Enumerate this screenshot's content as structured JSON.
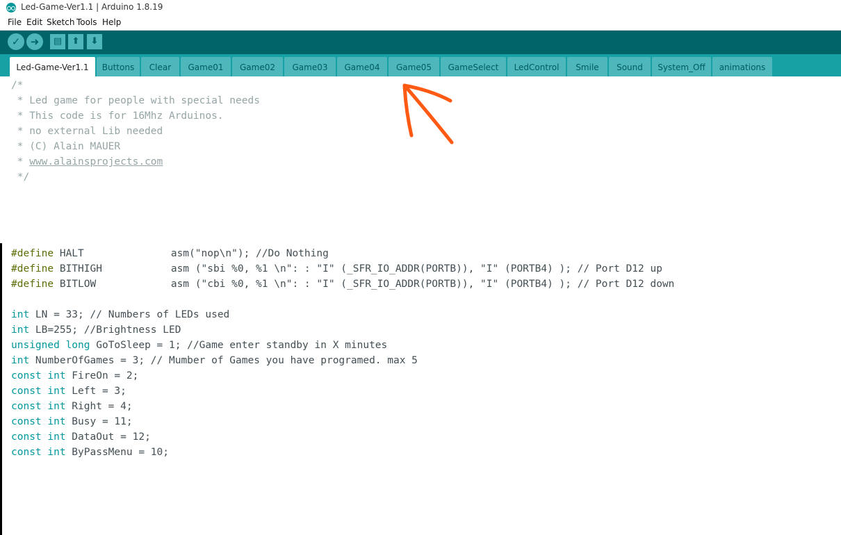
{
  "window": {
    "title": "Led-Game-Ver1.1 | Arduino 1.8.19"
  },
  "menu": [
    "File",
    "Edit",
    "Sketch",
    "Tools",
    "Help"
  ],
  "toolbar": {
    "verify_icon": "check-icon",
    "upload_icon": "arrow-right-icon",
    "new_icon": "new-document-icon",
    "open_icon": "arrow-up-icon",
    "save_icon": "arrow-down-icon"
  },
  "tabs": [
    "Led-Game-Ver1.1",
    "Buttons",
    "Clear",
    "Game01",
    "Game02",
    "Game03",
    "Game04",
    "Game05",
    "GameSelect",
    "LedControl",
    "Smile",
    "Sound",
    "System_Off",
    "animations"
  ],
  "active_tab": "Led-Game-Ver1.1",
  "colors": {
    "toolbar": "#006468",
    "tabstrip": "#17a1a5",
    "tab": "#4db7bb",
    "keyword": "#00979c",
    "comment": "#95a5a6",
    "annotation_arrow": "#ff5a14"
  },
  "code": {
    "comment_block": [
      "/*",
      " * Led game for people with special needs",
      " * This code is for 16Mhz Arduinos.",
      " * no external Lib needed",
      " * (C) Alain MAUER",
      " * ",
      " */"
    ],
    "comment_link": "www.alainsprojects.com",
    "defines": [
      {
        "name": "HALT",
        "body": "asm(\"nop\\n\"); //Do Nothing"
      },
      {
        "name": "BITHIGH",
        "body": "asm (\"sbi %0, %1 \\n\": : \"I\" (_SFR_IO_ADDR(PORTB)), \"I\" (PORTB4) ); // Port D12 up"
      },
      {
        "name": "BITLOW",
        "body": "asm (\"cbi %0, %1 \\n\": : \"I\" (_SFR_IO_ADDR(PORTB)), \"I\" (PORTB4) ); // Port D12 down"
      }
    ],
    "declarations": [
      {
        "type": "int",
        "rest": " LN = 33; // Numbers of LEDs used"
      },
      {
        "type": "int",
        "rest": " LB=255; //Brightness LED"
      },
      {
        "type": "unsigned long",
        "rest": " GoToSleep = 1; //Game enter standby in X minutes"
      },
      {
        "type": "int",
        "rest": " NumberOfGames = 3; // Mumber of Games you have programed. max 5"
      },
      {
        "type": "const int",
        "rest": " FireOn = 2;"
      },
      {
        "type": "const int",
        "rest": " Left = 3;"
      },
      {
        "type": "const int",
        "rest": " Right = 4;"
      },
      {
        "type": "const int",
        "rest": " Busy = 11;"
      },
      {
        "type": "const int",
        "rest": " DataOut = 12;"
      },
      {
        "type": "const int",
        "rest": " ByPassMenu = 10;"
      }
    ],
    "define_keyword": "#define"
  }
}
